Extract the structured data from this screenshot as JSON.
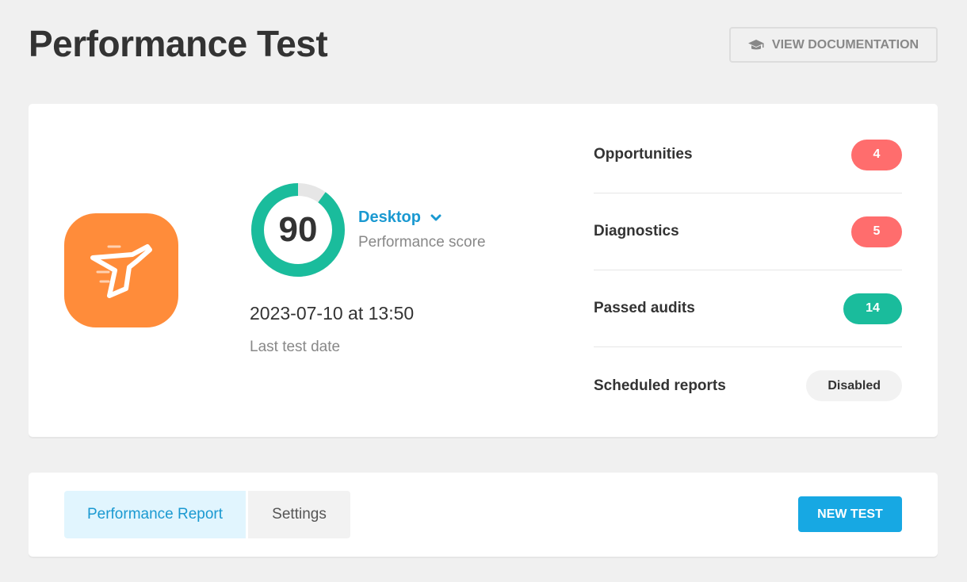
{
  "header": {
    "title": "Performance Test",
    "doc_button_label": "VIEW DOCUMENTATION",
    "doc_button_icon": "graduation-cap-icon"
  },
  "summary": {
    "logo_icon": "hummingbird-icon",
    "logo_color": "#ff8c3a",
    "score": "90",
    "score_fraction": 0.9,
    "score_color": "#1abc9c",
    "device": "Desktop",
    "score_label": "Performance score",
    "test_date": "2023-07-10 at 13:50",
    "test_date_label": "Last test date",
    "stats": [
      {
        "label": "Opportunities",
        "value": "4",
        "color": "#ff6d6d"
      },
      {
        "label": "Diagnostics",
        "value": "5",
        "color": "#ff6d6d"
      },
      {
        "label": "Passed audits",
        "value": "14",
        "color": "#1abc9c"
      },
      {
        "label": "Scheduled reports",
        "value": "Disabled",
        "color": "#f2f2f2"
      }
    ]
  },
  "tabs": {
    "items": [
      {
        "label": "Performance Report",
        "active": true
      },
      {
        "label": "Settings",
        "active": false
      }
    ],
    "new_test_label": "NEW TEST"
  }
}
